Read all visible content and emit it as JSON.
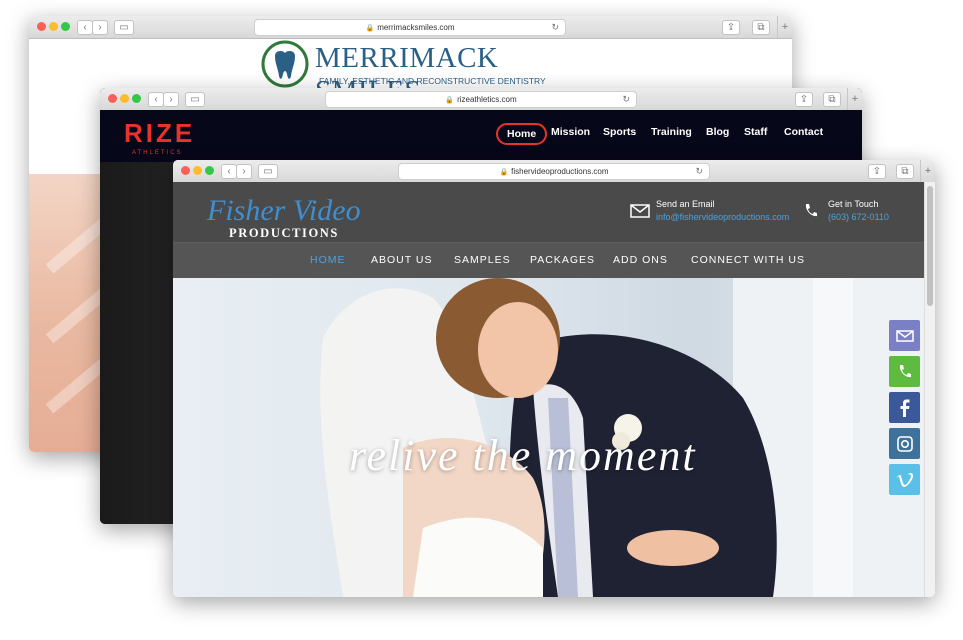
{
  "windows": {
    "merrimack": {
      "url": "merrimacksmiles.com",
      "logo_title": "MERRIMACK SMILES",
      "logo_subtitle": "FAMILY, ESTHETIC AND RECONSTRUCTIVE DENTISTRY"
    },
    "rize": {
      "url": "rizeathletics.com",
      "logo": "RIZE",
      "logo_sub": "ATHLETICS",
      "nav": [
        "Home",
        "Mission",
        "Sports",
        "Training",
        "Blog",
        "Staff",
        "Contact"
      ]
    },
    "fisher": {
      "url": "fishervideoproductions.com",
      "logo_script": "Fisher Video",
      "logo_block": "PRODUCTIONS",
      "email_label": "Send an Email",
      "email_value": "info@fishervideoproductions.com",
      "phone_label": "Get in Touch",
      "phone_value": "(603) 672-0110",
      "nav": [
        "HOME",
        "ABOUT US",
        "SAMPLES",
        "PACKAGES",
        "ADD ONS",
        "CONNECT WITH US"
      ],
      "tagline": "relive the moment",
      "social": [
        {
          "icon": "email-icon",
          "color": "#7b7fc4"
        },
        {
          "icon": "phone-icon",
          "color": "#5fbb3f"
        },
        {
          "icon": "facebook-icon",
          "color": "#3b5998"
        },
        {
          "icon": "instagram-icon",
          "color": "#3f729b"
        },
        {
          "icon": "vimeo-icon",
          "color": "#5bc0e8"
        }
      ]
    }
  },
  "colors": {
    "fisher_accent": "#4aa3e0",
    "rize_accent": "#e8332a",
    "merrimack_accent": "#2a5f86"
  }
}
